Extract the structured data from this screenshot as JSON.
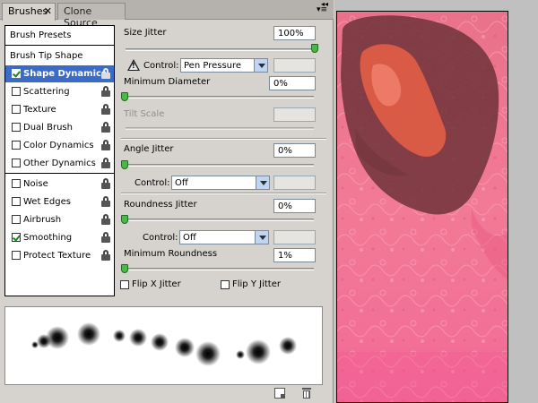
{
  "tabs": [
    {
      "label": "Brushes",
      "close": "✕"
    },
    {
      "label": "Clone Source"
    }
  ],
  "panel_menu_icon": "▾≡",
  "collapse_icon": "◂◂",
  "list": {
    "header": "Brush Presets",
    "items": [
      {
        "label": "Brush Tip Shape",
        "checkbox": false,
        "lock": false
      },
      {
        "label": "Shape Dynamics",
        "checkbox": true,
        "checked": true,
        "lock": true,
        "selected": true
      },
      {
        "label": "Scattering",
        "checkbox": true,
        "checked": false,
        "lock": true
      },
      {
        "label": "Texture",
        "checkbox": true,
        "checked": false,
        "lock": true
      },
      {
        "label": "Dual Brush",
        "checkbox": true,
        "checked": false,
        "lock": true
      },
      {
        "label": "Color Dynamics",
        "checkbox": true,
        "checked": false,
        "lock": true
      },
      {
        "label": "Other Dynamics",
        "checkbox": true,
        "checked": false,
        "lock": true
      },
      {
        "label": "Noise",
        "checkbox": true,
        "checked": false,
        "lock": true
      },
      {
        "label": "Wet Edges",
        "checkbox": true,
        "checked": false,
        "lock": true
      },
      {
        "label": "Airbrush",
        "checkbox": true,
        "checked": false,
        "lock": true
      },
      {
        "label": "Smoothing",
        "checkbox": true,
        "checked": true,
        "lock": true
      },
      {
        "label": "Protect Texture",
        "checkbox": true,
        "checked": false,
        "lock": true
      }
    ]
  },
  "controls": {
    "size_jitter": {
      "label": "Size Jitter",
      "value": "100%",
      "slider_fraction": 1.0
    },
    "size_control": {
      "label": "Control:",
      "selected": "Pen Pressure"
    },
    "min_diameter": {
      "label": "Minimum Diameter",
      "value": "0%",
      "slider_fraction": 0.0
    },
    "tilt_scale": {
      "label": "Tilt Scale",
      "value": ""
    },
    "angle_jitter": {
      "label": "Angle Jitter",
      "value": "0%",
      "slider_fraction": 0.0
    },
    "angle_control": {
      "label": "Control:",
      "selected": "Off"
    },
    "roundness_jitter": {
      "label": "Roundness Jitter",
      "value": "0%",
      "slider_fraction": 0.0
    },
    "roundness_control": {
      "label": "Control:",
      "selected": "Off"
    },
    "min_roundness": {
      "label": "Minimum Roundness",
      "value": "1%",
      "slider_fraction": 0.0
    },
    "flip_x": {
      "label": "Flip X Jitter",
      "checked": false
    },
    "flip_y": {
      "label": "Flip Y Jitter",
      "checked": false
    }
  },
  "colors": {
    "selection": "#3b6bc9",
    "slider_thumb": "#4bb84b",
    "canvas_pink": "#f06a8e",
    "canvas_dark": "#5a2a30"
  },
  "icons": [
    "close-icon",
    "panel-menu-icon",
    "lock-icon",
    "warning-icon",
    "chevron-down-icon",
    "new-brush-icon",
    "trash-icon"
  ]
}
